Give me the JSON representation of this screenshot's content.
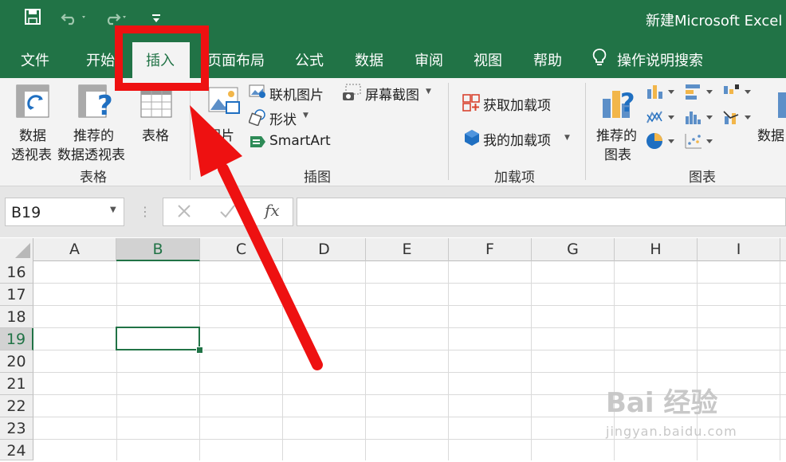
{
  "window": {
    "title": "新建Microsoft Excel 工"
  },
  "quick_access": {
    "save_icon": "save-icon",
    "undo_icon": "undo-icon",
    "redo_icon": "redo-icon",
    "customize_icon": "customize-icon"
  },
  "tabs": [
    {
      "label": "文件"
    },
    {
      "label": "开始"
    },
    {
      "label": "插入"
    },
    {
      "label": "页面布局"
    },
    {
      "label": "公式"
    },
    {
      "label": "数据"
    },
    {
      "label": "审阅"
    },
    {
      "label": "视图"
    },
    {
      "label": "帮助"
    }
  ],
  "tell_me": {
    "label": "操作说明搜索"
  },
  "ribbon": {
    "tables": {
      "group_label": "表格",
      "pivot": {
        "line1": "数据",
        "line2": "透视表"
      },
      "recommended_pivot": {
        "line1": "推荐的",
        "line2": "数据透视表"
      },
      "table": {
        "label": "表格"
      }
    },
    "illustrations": {
      "group_label": "插图",
      "pictures": {
        "label": "图片"
      },
      "online_pictures": {
        "label": "联机图片"
      },
      "shapes": {
        "label": "形状"
      },
      "smartart": {
        "label": "SmartArt"
      },
      "screenshot": {
        "label": "屏幕截图"
      }
    },
    "addins": {
      "group_label": "加载项",
      "get_addins": {
        "label": "获取加载项"
      },
      "my_addins": {
        "label": "我的加载项"
      }
    },
    "charts": {
      "group_label": "图表",
      "recommended": {
        "line1": "推荐的",
        "line2": "图表"
      },
      "data_partial": {
        "label": "数据"
      }
    }
  },
  "formula_bar": {
    "name_box": "B19",
    "fx": "fx",
    "formula": ""
  },
  "grid": {
    "columns": [
      "A",
      "B",
      "C",
      "D",
      "E",
      "F",
      "G",
      "H",
      "I"
    ],
    "rows": [
      "16",
      "17",
      "18",
      "19",
      "20",
      "21",
      "22",
      "23",
      "24"
    ],
    "active_column": "B",
    "active_row": "19"
  },
  "colors": {
    "brand": "#217346",
    "annotation": "#ee1111"
  },
  "watermark": {
    "line1": "Bai 经验",
    "line2": "jingyan.baidu.com"
  }
}
